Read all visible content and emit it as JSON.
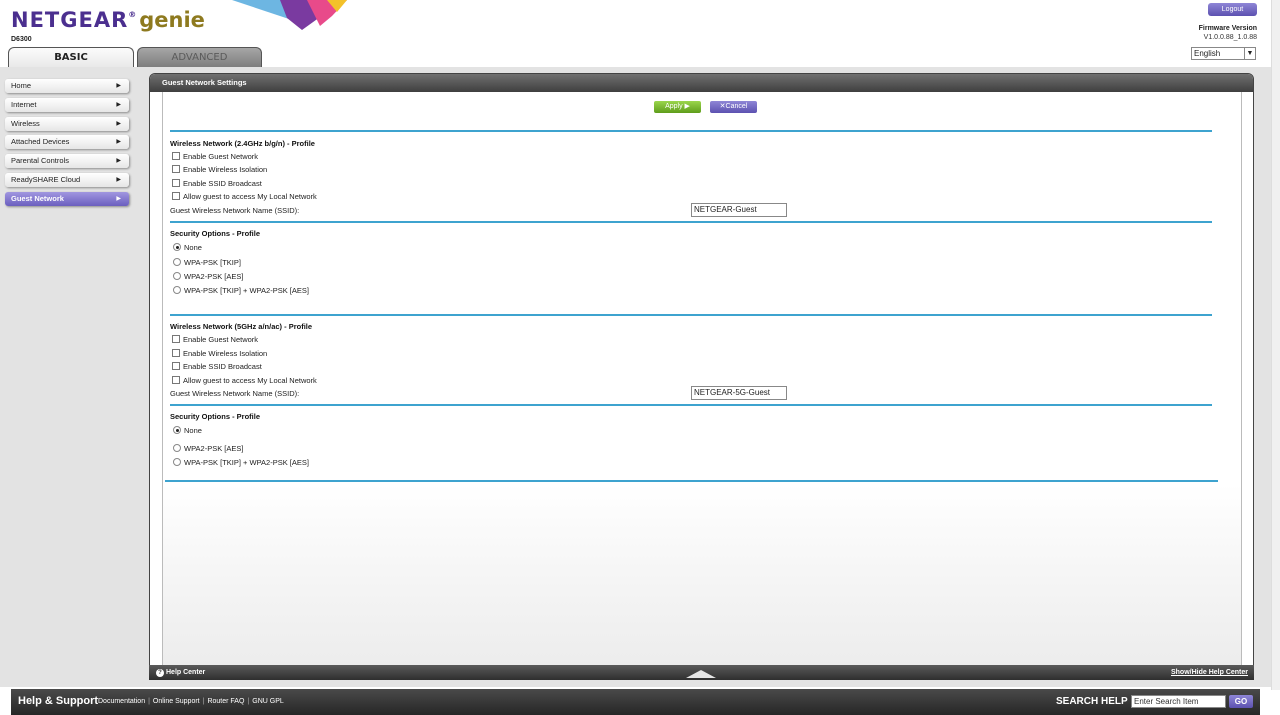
{
  "brand": {
    "name": "NETGEAR",
    "product": "genie",
    "model": "D6300"
  },
  "colors": {
    "accent_purple": "#5c51b0",
    "section_line": "#3da3cf",
    "apply_green": "#5f9d1b"
  },
  "tabs": {
    "basic": "BASIC",
    "advanced": "ADVANCED"
  },
  "header": {
    "logout": "Logout",
    "firmware_label": "Firmware Version",
    "firmware_value": "V1.0.0.88_1.0.88",
    "language": "English"
  },
  "sidebar": {
    "items": [
      {
        "label": "Home"
      },
      {
        "label": "Internet"
      },
      {
        "label": "Wireless"
      },
      {
        "label": "Attached Devices"
      },
      {
        "label": "Parental Controls"
      },
      {
        "label": "ReadySHARE Cloud"
      },
      {
        "label": "Guest Network"
      }
    ],
    "active": "Guest Network"
  },
  "panel": {
    "title": "Guest Network Settings",
    "apply": "Apply ▶",
    "cancel": "✕Cancel",
    "band24": {
      "title": "Wireless Network (2.4GHz b/g/n) - Profile",
      "options": [
        {
          "label": "Enable Guest Network",
          "checked": false
        },
        {
          "label": "Enable Wireless Isolation",
          "checked": false
        },
        {
          "label": "Enable SSID Broadcast",
          "checked": false
        },
        {
          "label": "Allow guest to access My Local Network",
          "checked": false
        }
      ],
      "ssid_label": "Guest Wireless Network Name (SSID):",
      "ssid_value": "NETGEAR-Guest",
      "security_title": "Security Options - Profile",
      "security": [
        {
          "label": "None",
          "selected": true
        },
        {
          "label": "WPA-PSK [TKIP]",
          "selected": false
        },
        {
          "label": "WPA2-PSK [AES]",
          "selected": false
        },
        {
          "label": "WPA-PSK [TKIP] + WPA2-PSK [AES]",
          "selected": false
        }
      ]
    },
    "band5": {
      "title": "Wireless Network (5GHz a/n/ac) - Profile",
      "options": [
        {
          "label": "Enable Guest Network",
          "checked": false
        },
        {
          "label": "Enable Wireless Isolation",
          "checked": false
        },
        {
          "label": "Enable SSID Broadcast",
          "checked": false
        },
        {
          "label": "Allow guest to access My Local Network",
          "checked": false
        }
      ],
      "ssid_label": "Guest Wireless Network Name (SSID):",
      "ssid_value": "NETGEAR-5G-Guest",
      "security_title": "Security Options - Profile",
      "security": [
        {
          "label": "None",
          "selected": true
        },
        {
          "label": "WPA2-PSK [AES]",
          "selected": false
        },
        {
          "label": "WPA-PSK [TKIP] + WPA2-PSK [AES]",
          "selected": false
        }
      ]
    }
  },
  "helpbar": {
    "label": "Help Center",
    "toggle": "Show/Hide Help Center"
  },
  "footer": {
    "title": "Help & Support",
    "links": [
      "Documentation",
      "Online Support",
      "Router FAQ",
      "GNU GPL"
    ],
    "search_help": "SEARCH HELP",
    "search_placeholder": "Enter Search Item",
    "go": "GO"
  }
}
